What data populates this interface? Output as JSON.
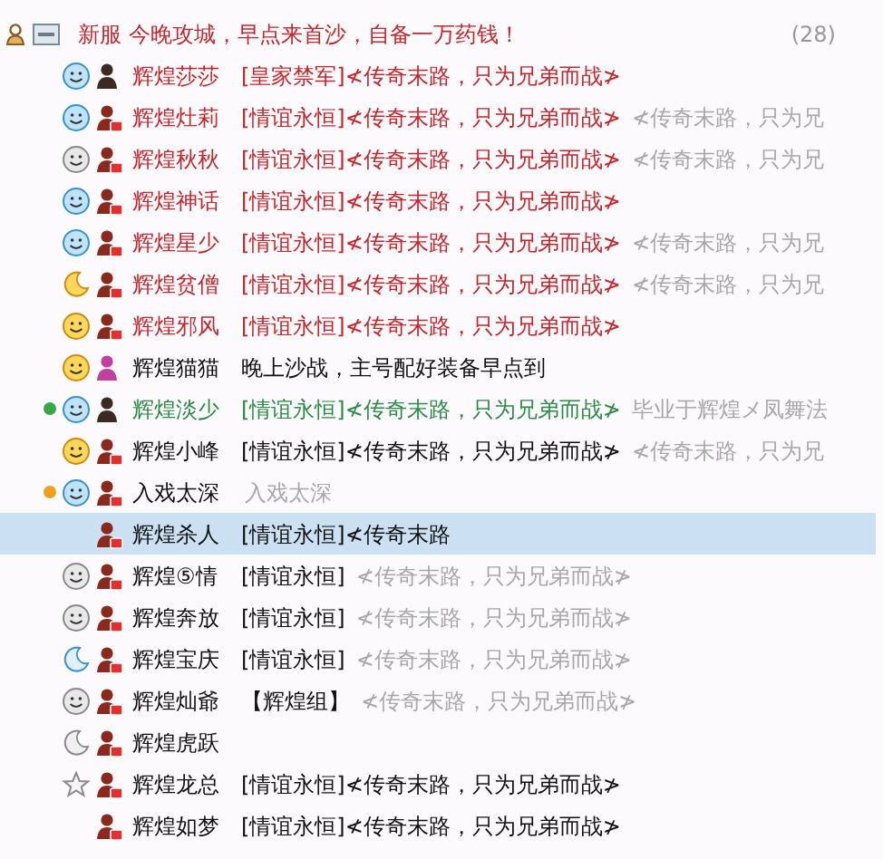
{
  "group": {
    "title": "新服 今晚攻城，早点来首沙，自备一万药钱！",
    "count": "(28)",
    "expanded": true
  },
  "members": [
    {
      "name": "辉煌莎莎",
      "vip": true,
      "special": false,
      "kind": "online",
      "badge": false,
      "female": false,
      "signature": "[皇家禁军]≮传奇末路，只为兄弟而战≯",
      "selected": false
    },
    {
      "name": "辉煌灶莉",
      "vip": true,
      "special": false,
      "kind": "online",
      "badge": true,
      "female": false,
      "signature": "[情谊永恒]≮传奇末路，只为兄弟而战≯",
      "note": "≮传奇末路，只为兄",
      "selected": false
    },
    {
      "name": "辉煌秋秋",
      "vip": true,
      "special": false,
      "kind": "offline",
      "badge": true,
      "female": false,
      "signature": "[情谊永恒]≮传奇末路，只为兄弟而战≯",
      "note": "≮传奇末路，只为兄",
      "selected": false
    },
    {
      "name": "辉煌神话",
      "vip": true,
      "special": false,
      "kind": "online",
      "badge": true,
      "female": false,
      "signature": "[情谊永恒]≮传奇末路，只为兄弟而战≯",
      "selected": false
    },
    {
      "name": "辉煌星少",
      "vip": true,
      "special": false,
      "kind": "online",
      "badge": true,
      "female": false,
      "signature": "[情谊永恒]≮传奇末路，只为兄弟而战≯",
      "note": "≮传奇末路，只为兄",
      "selected": false
    },
    {
      "name": "辉煌贫僧",
      "vip": true,
      "special": false,
      "kind": "sunny",
      "badge": true,
      "female": false,
      "signature": "[情谊永恒]≮传奇末路，只为兄弟而战≯",
      "note": "≮传奇末路，只为兄",
      "selected": false
    },
    {
      "name": "辉煌邪风",
      "vip": true,
      "special": false,
      "kind": "happy",
      "badge": true,
      "female": false,
      "signature": "[情谊永恒]≮传奇末路，只为兄弟而战≯",
      "selected": false
    },
    {
      "name": "辉煌猫猫",
      "vip": false,
      "special": false,
      "kind": "happy",
      "badge": false,
      "female": true,
      "signature": "晚上沙战，主号配好装备早点到",
      "selected": false
    },
    {
      "name": "辉煌淡少",
      "vip": false,
      "special": true,
      "kind": "online",
      "badge": false,
      "female": false,
      "color": "#3aa64a",
      "signature": "[情谊永恒]≮传奇末路，只为兄弟而战≯",
      "note": "毕业于辉煌メ凤舞法",
      "selected": false
    },
    {
      "name": "辉煌小峰",
      "vip": false,
      "special": false,
      "kind": "happy",
      "badge": true,
      "female": false,
      "signature": "[情谊永恒]≮传奇末路，只为兄弟而战≯",
      "note": "≮传奇末路，只为兄",
      "selected": false
    },
    {
      "name": "入戏太深",
      "vip": false,
      "special": false,
      "kind": "online",
      "badge": true,
      "female": false,
      "color": "#f0a020",
      "note": "入戏太深",
      "selected": false
    },
    {
      "name": "辉煌杀人",
      "vip": false,
      "special": false,
      "kind": "none",
      "badge": true,
      "female": false,
      "signature": "[情谊永恒]≮传奇末路",
      "selected": true
    },
    {
      "name": "辉煌⑤情",
      "vip": false,
      "special": false,
      "kind": "offline",
      "badge": true,
      "female": false,
      "signature": "[情谊永恒]",
      "note": "≮传奇末路，只为兄弟而战≯",
      "selected": false
    },
    {
      "name": "辉煌奔放",
      "vip": false,
      "special": false,
      "kind": "offline",
      "badge": true,
      "female": false,
      "signature": "[情谊永恒]",
      "note": "≮传奇末路，只为兄弟而战≯",
      "selected": false
    },
    {
      "name": "辉煌宝庆",
      "vip": false,
      "special": false,
      "kind": "away",
      "badge": true,
      "female": false,
      "signature": "[情谊永恒]",
      "note": "≮传奇末路，只为兄弟而战≯",
      "selected": false
    },
    {
      "name": "辉煌灿爺",
      "vip": false,
      "special": false,
      "kind": "offline",
      "badge": true,
      "female": false,
      "signature": "【辉煌组】",
      "note": "≮传奇末路，只为兄弟而战≯",
      "selected": false
    },
    {
      "name": "辉煌虎跃",
      "vip": false,
      "special": false,
      "kind": "asleep",
      "badge": true,
      "female": false,
      "selected": false
    },
    {
      "name": "辉煌龙总",
      "vip": false,
      "special": false,
      "kind": "star",
      "badge": true,
      "female": false,
      "signature": "[情谊永恒]≮传奇末路，只为兄弟而战≯",
      "selected": false
    },
    {
      "name": "辉煌如梦",
      "vip": false,
      "special": false,
      "kind": "none",
      "badge": true,
      "female": false,
      "signature": "[情谊永恒]≮传奇末路，只为兄弟而战≯",
      "selected": false
    }
  ]
}
